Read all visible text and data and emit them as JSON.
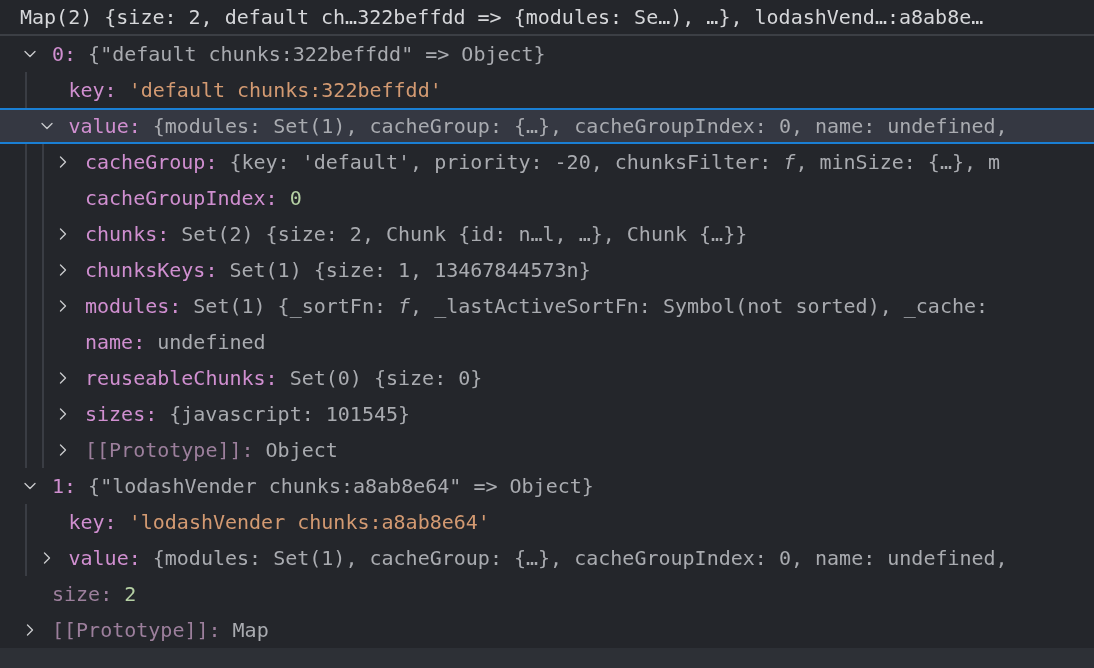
{
  "header": "Map(2) {size: 2, default ch…322beffdd => {modules: Se…), …}, lodashVend…:a8ab8e…",
  "tree": [
    {
      "name": "0:",
      "value": "{\"default chunks:322beffdd\" => Object}",
      "kind": "object",
      "expanded": true,
      "selected": false,
      "internal": false,
      "children": [
        {
          "name": "key:",
          "value": "'default chunks:322beffdd'",
          "kind": "string",
          "selected": false,
          "internal": false
        },
        {
          "name": "value:",
          "value": "{modules: Set(1), cacheGroup: {…}, cacheGroupIndex: 0, name: undefined,",
          "kind": "object",
          "expanded": true,
          "selected": true,
          "internal": false,
          "children": [
            {
              "name": "cacheGroup:",
              "value": "{key: 'default', priority: -20, chunksFilter: *f*, minSize: {…}, m",
              "kind": "object",
              "expanded": false,
              "selected": false,
              "internal": false
            },
            {
              "name": "cacheGroupIndex:",
              "value": "0",
              "kind": "number",
              "selected": false,
              "internal": false
            },
            {
              "name": "chunks:",
              "value": "Set(2) {size: 2, Chunk {id: n…l, …}, Chunk {…}}",
              "kind": "object",
              "expanded": false,
              "selected": false,
              "internal": false
            },
            {
              "name": "chunksKeys:",
              "value": "Set(1) {size: 1, 13467844573n}",
              "kind": "object",
              "expanded": false,
              "selected": false,
              "internal": false
            },
            {
              "name": "modules:",
              "value": "Set(1) {_sortFn: *f*, _lastActiveSortFn: Symbol(not sorted), _cache:",
              "kind": "object",
              "expanded": false,
              "selected": false,
              "internal": false
            },
            {
              "name": "name:",
              "value": "undefined",
              "kind": "object",
              "selected": false,
              "internal": false
            },
            {
              "name": "reuseableChunks:",
              "value": "Set(0) {size: 0}",
              "kind": "object",
              "expanded": false,
              "selected": false,
              "internal": false
            },
            {
              "name": "sizes:",
              "value": "{javascript: 101545}",
              "kind": "object",
              "expanded": false,
              "selected": false,
              "internal": false
            },
            {
              "name": "[[Prototype]]:",
              "value": "Object",
              "kind": "object",
              "expanded": false,
              "selected": false,
              "internal": true
            }
          ]
        }
      ]
    },
    {
      "name": "1:",
      "value": "{\"lodashVender chunks:a8ab8e64\" => Object}",
      "kind": "object",
      "expanded": true,
      "selected": false,
      "internal": false,
      "children": [
        {
          "name": "key:",
          "value": "'lodashVender chunks:a8ab8e64'",
          "kind": "string",
          "selected": false,
          "internal": false
        },
        {
          "name": "value:",
          "value": "{modules: Set(1), cacheGroup: {…}, cacheGroupIndex: 0, name: undefined,",
          "kind": "object",
          "expanded": false,
          "selected": false,
          "internal": false
        }
      ]
    },
    {
      "name": "size:",
      "value": "2",
      "kind": "number",
      "selected": false,
      "internal": true
    },
    {
      "name": "[[Prototype]]:",
      "value": "Map",
      "kind": "object",
      "expanded": false,
      "selected": false,
      "internal": true
    }
  ]
}
